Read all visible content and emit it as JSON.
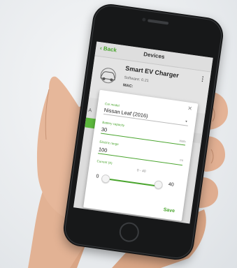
{
  "header": {
    "back_label": "Back",
    "title": "Devices"
  },
  "device": {
    "name": "Smart EV Charger",
    "software_label": "Software: 0.21",
    "mac_label": "MAC:",
    "menu_icon": "more-vert-icon",
    "avatar_icon": "car-icon"
  },
  "background_row": {
    "label": "A"
  },
  "dialog": {
    "close_icon": "close-icon",
    "car_model": {
      "label": "Car model",
      "value": "Nissan Leaf (2016)"
    },
    "battery_capacity": {
      "label": "Battery capacity",
      "value": "30",
      "unit": "kWh"
    },
    "electric_range": {
      "label": "Electric range",
      "value": "100",
      "unit": "mi"
    },
    "current": {
      "label": "Current (A)",
      "range_label": "0 - 40",
      "min_value": "0",
      "max_value": "40"
    },
    "save_label": "Save"
  },
  "colors": {
    "accent": "#4aa52e",
    "phone_body": "#171819",
    "skin": "#e2b294"
  }
}
